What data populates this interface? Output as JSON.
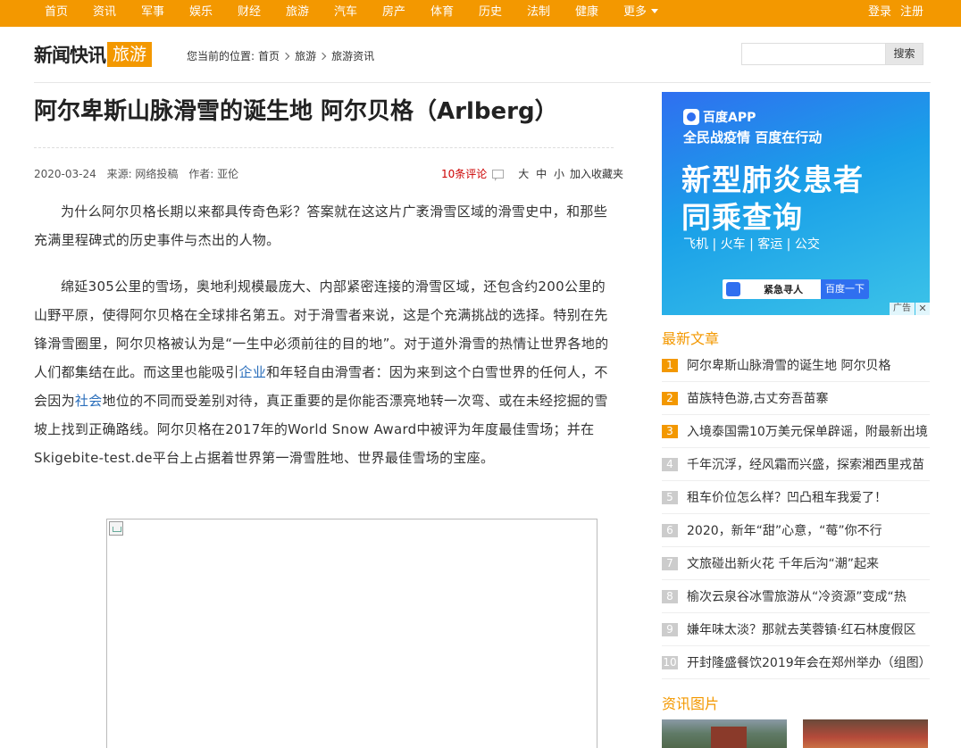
{
  "nav": {
    "items": [
      "首页",
      "资讯",
      "军事",
      "娱乐",
      "财经",
      "旅游",
      "汽车",
      "房产",
      "体育",
      "历史",
      "法制",
      "健康",
      "更多"
    ],
    "login": "登录",
    "register": "注册"
  },
  "header": {
    "logo_main": "新闻快讯",
    "logo_tag": "旅游",
    "breadcrumb_label": "您当前的位置:",
    "breadcrumb": [
      "首页",
      "旅游",
      "旅游资讯"
    ],
    "search_placeholder": "",
    "search_button": "搜索"
  },
  "article": {
    "title": "阿尔卑斯山脉滑雪的诞生地 阿尔贝格（Arlberg）",
    "date": "2020-03-24",
    "source": "来源: 网络投稿",
    "author": "作者: 亚伦",
    "comments": "10条评论",
    "size_large": "大",
    "size_medium": "中",
    "size_small": "小",
    "favorite": "加入收藏夹",
    "p1": "为什么阿尔贝格长期以来都具传奇色彩？答案就在这这片广袤滑雪区域的滑雪史中，和那些充满里程碑式的历史事件与杰出的人物。",
    "p2_a": "绵延305公里的雪场，奥地利规模最庞大、内部紧密连接的滑雪区域，还包含约200公里的山野平原，使得阿尔贝格在全球排名第五。对于滑雪者来说，这是个充满挑战的选择。特别在先锋滑雪圈里，阿尔贝格被认为是“一生中必须前往的目的地”。对于道外滑雪的热情让世界各地的人们都集结在此。而这里也能吸引",
    "p2_link1": "企业",
    "p2_b": "和年轻自由滑雪者：因为来到这个白雪世界的任何人，不会因为",
    "p2_link2": "社会",
    "p2_c": "地位的不同而受差别对待，真正重要的是你能否漂亮地转一次弯、或在未经挖掘的雪坡上找到正确路线。阿尔贝格在2017年的World Snow Award中被评为年度最佳雪场；并在Skigebite-test.de平台上占据着世界第一滑雪胜地、世界最佳雪场的宝座。"
  },
  "ad": {
    "brand": "百度APP",
    "slogan": "全民战疫情 百度在行动",
    "headline1": "新型肺炎患者",
    "headline2": "同乘查询",
    "modes": "飞机 | 火车 | 客运 | 公交",
    "query": "紧急寻人",
    "go": "百度一下",
    "tag": "广告",
    "close": "✕"
  },
  "latest": {
    "title": "最新文章",
    "items": [
      "阿尔卑斯山脉滑雪的诞生地 阿尔贝格",
      "苗族特色游,古丈夯吾苗寨",
      "入境泰国需10万美元保单辟谣，附最新出境",
      "千年沉浮，经风霜而兴盛，探索湘西里戎苗",
      "租车价位怎么样？凹凸租车我爱了！",
      "2020，新年“甜”心意，“莓”你不行",
      "文旅碰出新火花 千年后沟“潮”起来",
      "榆次云泉谷冰雪旅游从“冷资源”变成“热",
      "嫌年味太淡？那就去芙蓉镇·红石林度假区",
      "开封隆盛餐饮2019年会在郑州举办（组图）"
    ],
    "numbers": [
      "1",
      "2",
      "3",
      "4",
      "5",
      "6",
      "7",
      "8",
      "9",
      "10"
    ]
  },
  "pictures": {
    "title": "资讯图片"
  },
  "colors": {
    "accent": "#f39800",
    "link": "#2a6ebb",
    "comment": "#cc0000"
  }
}
